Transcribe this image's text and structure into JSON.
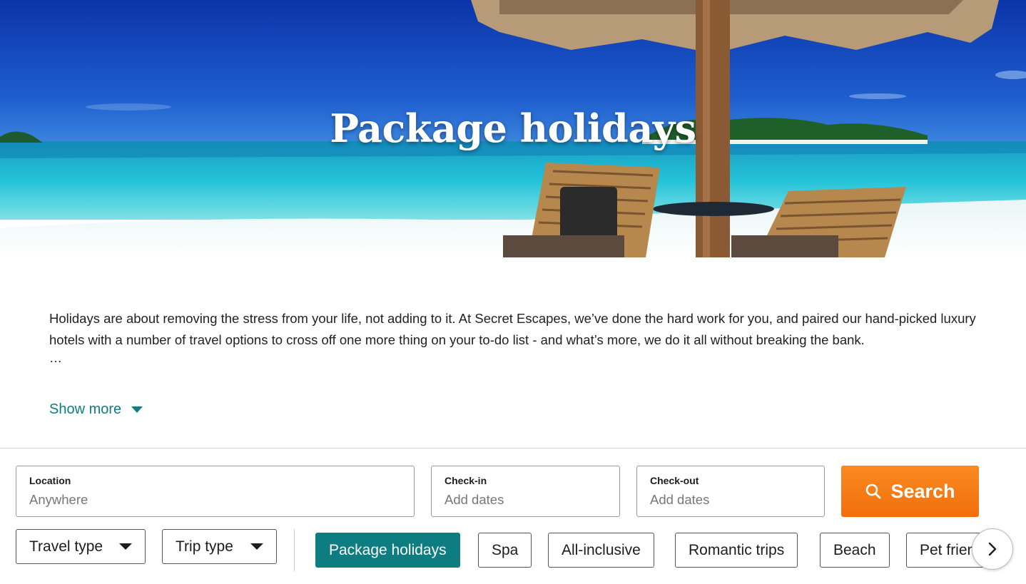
{
  "hero": {
    "title": "Package holidays"
  },
  "intro": {
    "text": "Holidays are about removing the stress from your life, not adding to it. At Secret Escapes, we’ve done the hard work for you, and paired our hand-picked luxury hotels with a number of travel options to cross off one more thing on your to-do list - and what’s more, we do it all without breaking the bank.",
    "ellipsis": "…",
    "show_more": "Show more"
  },
  "search": {
    "location_label": "Location",
    "location_placeholder": "Anywhere",
    "checkin_label": "Check-in",
    "checkin_placeholder": "Add dates",
    "checkout_label": "Check-out",
    "checkout_placeholder": "Add dates",
    "search_label": "Search"
  },
  "filters": {
    "travel_type": "Travel type",
    "trip_type": "Trip type",
    "chips": [
      "Package holidays",
      "Spa",
      "All-inclusive",
      "Romantic trips",
      "Beach",
      "Pet friendly"
    ],
    "active_chip": "Package holidays"
  },
  "colors": {
    "accent_teal": "#0e7d82",
    "search_orange": "#f27a10"
  },
  "icons": {
    "search": "search-icon",
    "show_more": "caret-down-icon",
    "dropdown": "caret-down-icon",
    "next": "chevron-right-icon"
  }
}
